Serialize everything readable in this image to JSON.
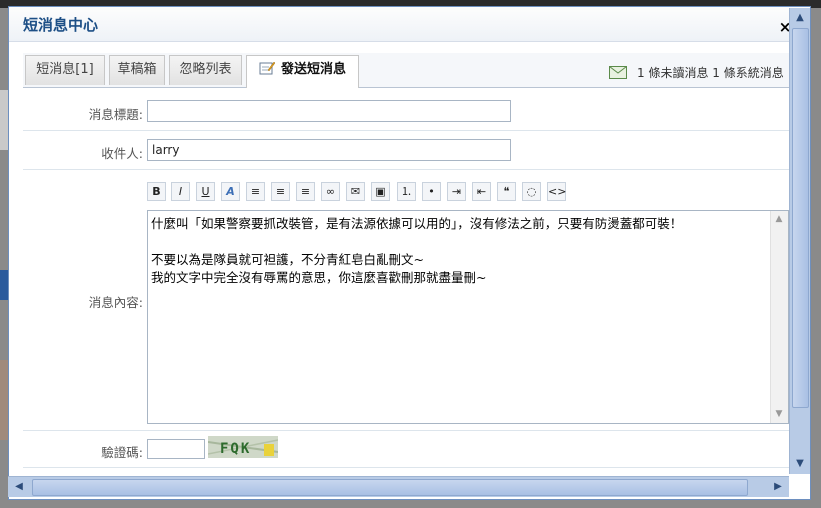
{
  "window": {
    "title": "短消息中心",
    "close_glyph": "×"
  },
  "tabs": [
    {
      "label": "短消息[1]"
    },
    {
      "label": "草稿箱"
    },
    {
      "label": "忽略列表"
    },
    {
      "label": "發送短消息",
      "icon": "compose-icon",
      "active": true
    }
  ],
  "status": {
    "icon": "mail-icon",
    "text": "1  條未讀消息 1  條系統消息"
  },
  "form": {
    "subject_label": "消息標題:",
    "subject_value": "",
    "recipient_label": "收件人:",
    "recipient_value": "larry",
    "content_label": "消息內容:",
    "content_lines": [
      "什麼叫「如果警察要抓改裝管，是有法源依據可以用的」，沒有修法之前，只要有防燙蓋都可裝！",
      "",
      "不要以為是隊員就可袒護，不分青紅皂白亂刪文~",
      "我的文字中完全沒有辱罵的意思，你這麼喜歡刪那就盡量刪~"
    ],
    "captcha_label": "驗證碼:",
    "captcha_text": "FQK"
  },
  "toolbar": [
    {
      "name": "bold-button",
      "glyph": "B"
    },
    {
      "name": "italic-button",
      "glyph": "I"
    },
    {
      "name": "underline-button",
      "glyph": "U"
    },
    {
      "name": "font-color-button",
      "glyph": "A"
    },
    {
      "name": "align-left-button",
      "glyph": "≡"
    },
    {
      "name": "align-center-button",
      "glyph": "≡"
    },
    {
      "name": "align-right-button",
      "glyph": "≡"
    },
    {
      "name": "link-button",
      "glyph": "∞"
    },
    {
      "name": "email-button",
      "glyph": "✉"
    },
    {
      "name": "image-button",
      "glyph": "▣"
    },
    {
      "name": "ordered-list-button",
      "glyph": "⒈"
    },
    {
      "name": "unordered-list-button",
      "glyph": "•"
    },
    {
      "name": "indent-button",
      "glyph": "⇥"
    },
    {
      "name": "outdent-button",
      "glyph": "⇤"
    },
    {
      "name": "quote-button",
      "glyph": "❝"
    },
    {
      "name": "comment-button",
      "glyph": "◌"
    },
    {
      "name": "code-button",
      "glyph": "<>"
    }
  ],
  "colors": {
    "accent": "#1d4f86",
    "scrollbar": "#b8cbe6"
  }
}
